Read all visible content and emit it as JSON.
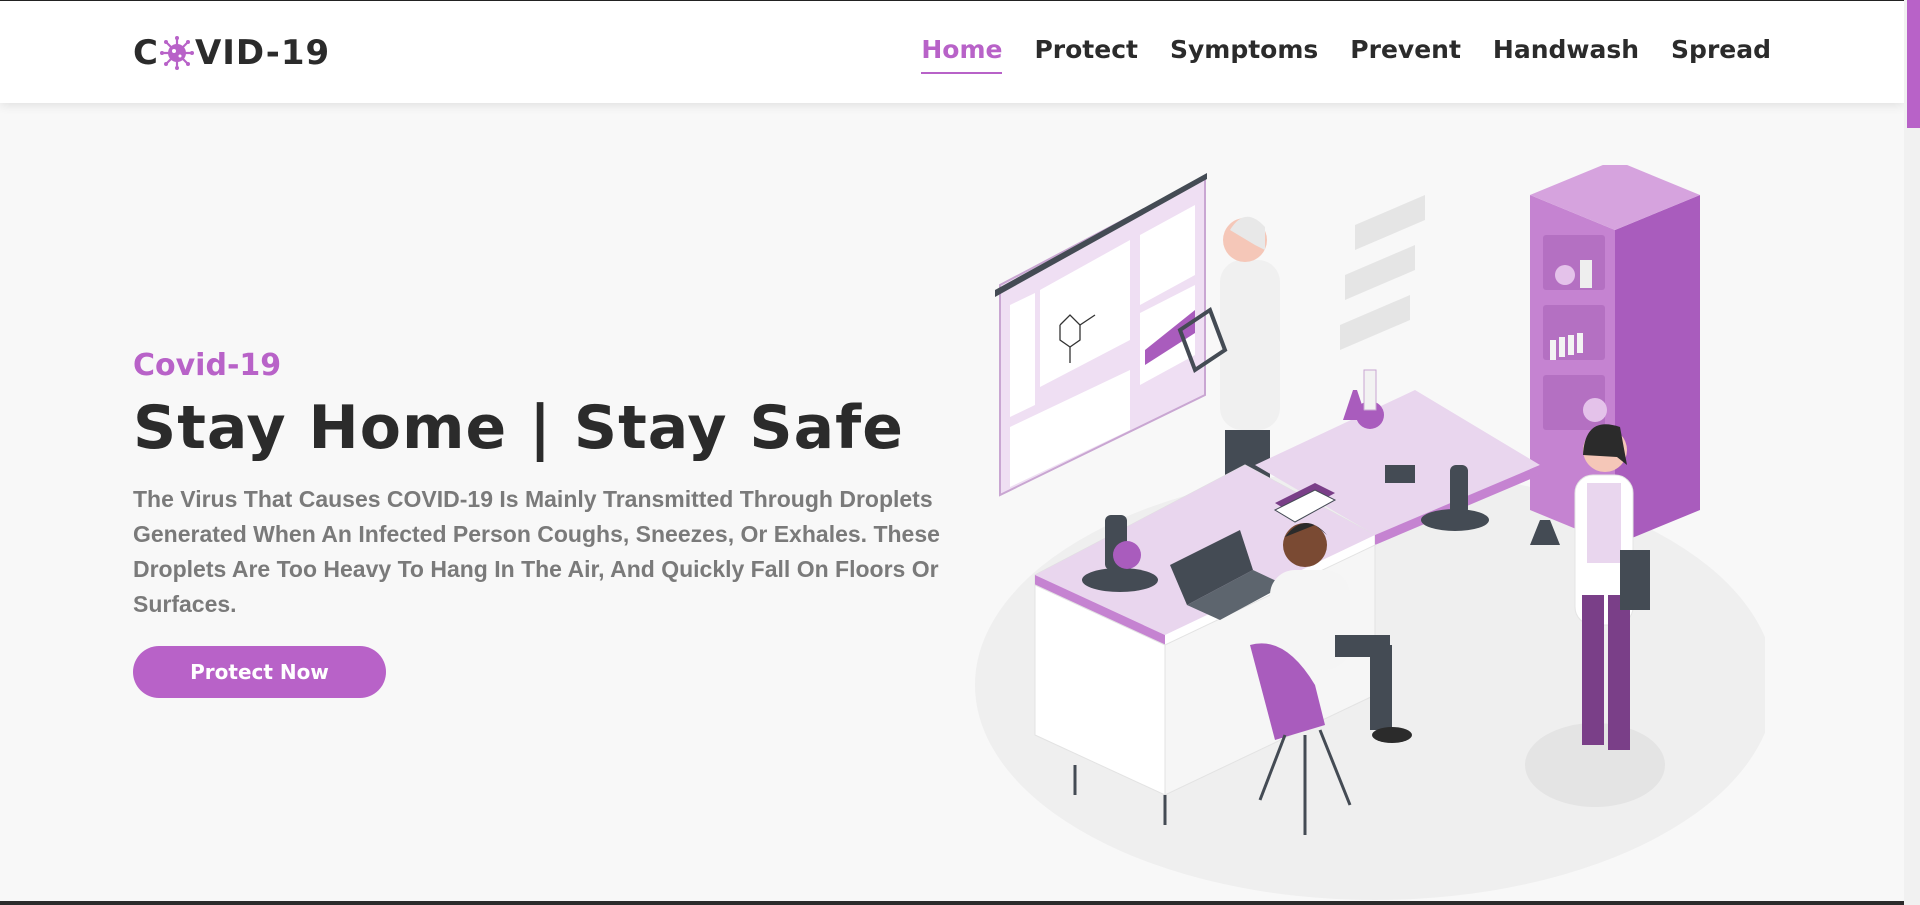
{
  "header": {
    "logo_prefix": "C",
    "logo_suffix": "VID-19",
    "nav": [
      {
        "label": "Home",
        "active": true
      },
      {
        "label": "Protect",
        "active": false
      },
      {
        "label": "Symptoms",
        "active": false
      },
      {
        "label": "Prevent",
        "active": false
      },
      {
        "label": "Handwash",
        "active": false
      },
      {
        "label": "Spread",
        "active": false
      }
    ]
  },
  "hero": {
    "subtitle": "Covid-19",
    "title": "Stay Home | Stay Safe",
    "description": "The Virus That Causes COVID-19 Is Mainly Transmitted Through Droplets Generated When An Infected Person Coughs, Sneezes, Or Exhales. These Droplets Are Too Heavy To Hang In The Air, And Quickly Fall On Floors Or Surfaces.",
    "button_label": "Protect Now"
  },
  "colors": {
    "accent": "#b862c8",
    "text_dark": "#2b2b2b",
    "text_muted": "#7a7a7a",
    "background": "#f8f8f8"
  },
  "icons": {
    "logo_virus": "virus-icon",
    "illustration": "laboratory-illustration"
  }
}
